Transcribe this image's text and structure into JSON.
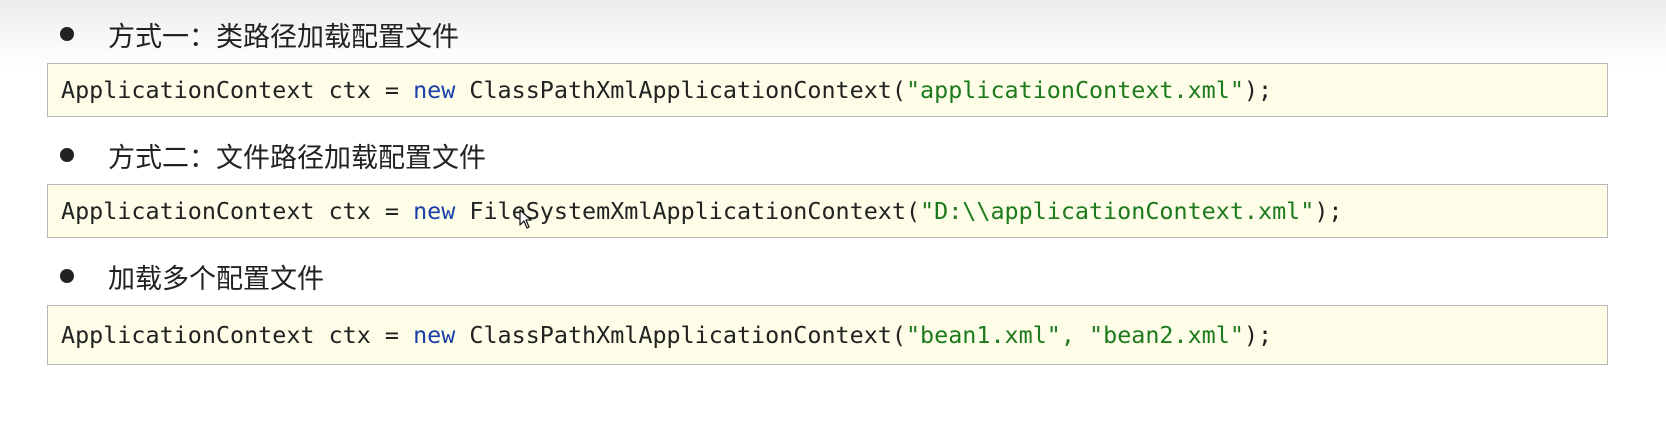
{
  "sections": [
    {
      "heading": "方式一：类路径加载配置文件",
      "code": {
        "prefix": "ApplicationContext ctx = ",
        "keyword": "new",
        "call": " ClassPathXmlApplicationContext(",
        "args": "\"applicationContext.xml\"",
        "suffix": ");"
      }
    },
    {
      "heading": "方式二：文件路径加载配置文件",
      "code": {
        "prefix": "ApplicationContext ctx = ",
        "keyword": "new",
        "call": " FileSystemXmlApplicationContext(",
        "args": "\"D:\\\\applicationContext.xml\"",
        "suffix": ");"
      }
    },
    {
      "heading": "加载多个配置文件",
      "code": {
        "prefix": "ApplicationContext ctx = ",
        "keyword": "new",
        "call": " ClassPathXmlApplicationContext(",
        "args": "\"bean1.xml\", \"bean2.xml\"",
        "suffix": ");"
      }
    }
  ],
  "colors": {
    "keyword": "#1a3fa8",
    "string": "#1d7a1d",
    "code_background": "#fdfde8",
    "text": "#222222"
  }
}
